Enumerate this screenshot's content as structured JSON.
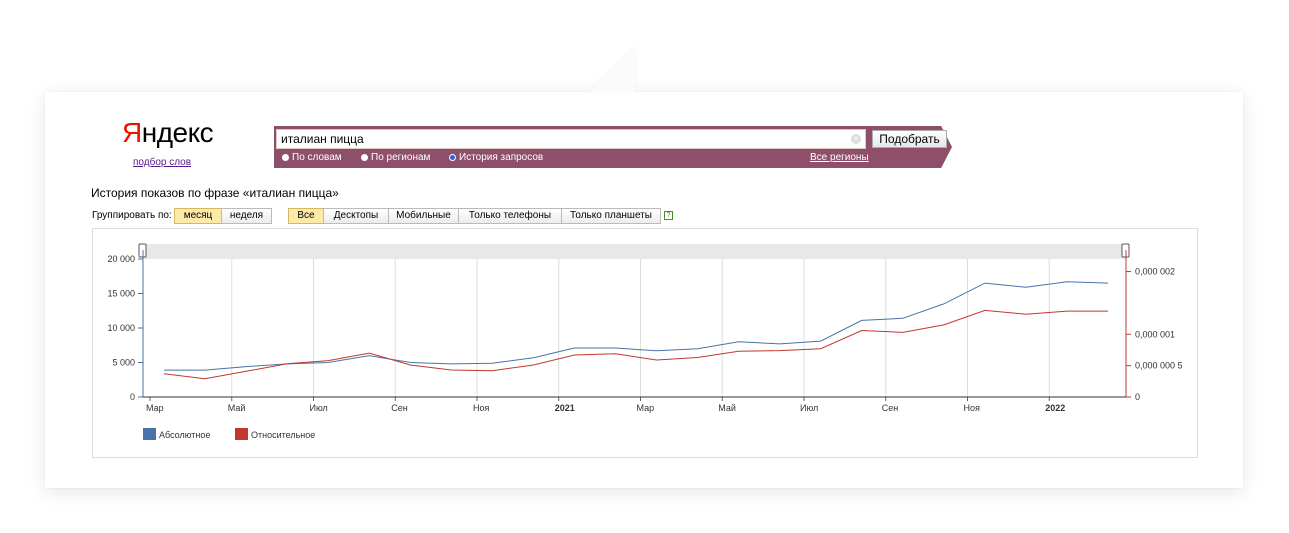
{
  "brand": {
    "logo_first": "Я",
    "logo_rest": "ндекс",
    "subtitle": "подбор слов"
  },
  "search": {
    "query": "италиан пицца",
    "button_label": "Подобрать",
    "regions_link": "Все регионы"
  },
  "modes": [
    {
      "label": "По словам",
      "selected": false
    },
    {
      "label": "По регионам",
      "selected": false
    },
    {
      "label": "История запросов",
      "selected": true
    }
  ],
  "history_title": "История показов по фразе «италиан пицца»",
  "group_by": {
    "label": "Группировать по:",
    "options": [
      "месяц",
      "неделя"
    ],
    "selected": "месяц"
  },
  "device_filters": {
    "options": [
      "Все",
      "Десктопы",
      "Мобильные",
      "Только телефоны",
      "Только планшеты"
    ],
    "selected": "Все"
  },
  "help_glyph": "?",
  "chart_data": {
    "type": "line",
    "x": [
      "2020-03",
      "2020-04",
      "2020-05",
      "2020-06",
      "2020-07",
      "2020-08",
      "2020-09",
      "2020-10",
      "2020-11",
      "2020-12",
      "2021-01",
      "2021-02",
      "2021-03",
      "2021-04",
      "2021-05",
      "2021-06",
      "2021-07",
      "2021-08",
      "2021-09",
      "2021-10",
      "2021-11",
      "2021-12",
      "2022-01",
      "2022-02"
    ],
    "x_tick_labels": [
      "Мар",
      "Май",
      "Июл",
      "Сен",
      "Ноя",
      "2021",
      "Мар",
      "Май",
      "Июл",
      "Сен",
      "Ноя",
      "2022"
    ],
    "left_axis": {
      "ticks": [
        "0",
        "5 000",
        "10 000",
        "15 000",
        "20 000"
      ],
      "ylim": [
        0,
        20000
      ]
    },
    "right_axis": {
      "ticks": [
        "0",
        "0,000 000 5",
        "0,000 001",
        "0,000 002"
      ],
      "ylim": [
        0,
        2.2e-06
      ]
    },
    "series": [
      {
        "name": "Абсолютное",
        "color": "#4a72a8",
        "axis": "left",
        "values": [
          3900,
          3900,
          4400,
          4800,
          5000,
          6000,
          5000,
          4800,
          4900,
          5700,
          7100,
          7100,
          6700,
          7000,
          8000,
          7700,
          8100,
          11100,
          11400,
          13500,
          16500,
          15900,
          16700,
          16500
        ]
      },
      {
        "name": "Относительное",
        "color": "#c0392b",
        "axis": "right",
        "values": [
          3.7e-07,
          2.9e-07,
          4.1e-07,
          5.3e-07,
          5.8e-07,
          7e-07,
          5.1e-07,
          4.3e-07,
          4.2e-07,
          5.1e-07,
          6.7e-07,
          6.9e-07,
          5.9e-07,
          6.3e-07,
          7.3e-07,
          7.4e-07,
          7.7e-07,
          1.06e-06,
          1.03e-06,
          1.15e-06,
          1.38e-06,
          1.32e-06,
          1.37e-06,
          1.37e-06
        ]
      }
    ]
  },
  "colors": {
    "band": "#8e4f6b",
    "active_toggle": "#fde9a8",
    "logo_red": "#e61400"
  }
}
